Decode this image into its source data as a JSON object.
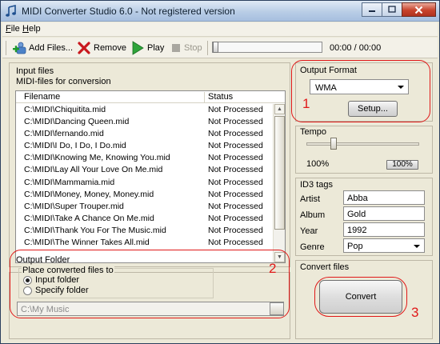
{
  "window": {
    "title": "MIDI Converter Studio 6.0 - Not registered version"
  },
  "menu": {
    "file": "File",
    "help": "Help"
  },
  "toolbar": {
    "add_files": "Add Files...",
    "remove": "Remove",
    "play": "Play",
    "stop": "Stop",
    "time": "00:00 / 00:00",
    "playback_progress": 0
  },
  "input_files": {
    "title": "Input files",
    "subtitle": "MIDI-files for conversion",
    "columns": {
      "filename": "Filename",
      "status": "Status"
    },
    "rows": [
      {
        "filename": "C:\\MIDI\\Chiquitita.mid",
        "status": "Not Processed"
      },
      {
        "filename": "C:\\MIDI\\Dancing Queen.mid",
        "status": "Not Processed"
      },
      {
        "filename": "C:\\MIDI\\fernando.mid",
        "status": "Not Processed"
      },
      {
        "filename": "C:\\MIDI\\I Do, I Do, I Do.mid",
        "status": "Not Processed"
      },
      {
        "filename": "C:\\MIDI\\Knowing Me, Knowing You.mid",
        "status": "Not Processed"
      },
      {
        "filename": "C:\\MIDI\\Lay All Your Love On Me.mid",
        "status": "Not Processed"
      },
      {
        "filename": "C:\\MIDI\\Mammamia.mid",
        "status": "Not Processed"
      },
      {
        "filename": "C:\\MIDI\\Money, Money, Money.mid",
        "status": "Not Processed"
      },
      {
        "filename": "C:\\MIDI\\Super Trouper.mid",
        "status": "Not Processed"
      },
      {
        "filename": "C:\\MIDI\\Take A Chance On Me.mid",
        "status": "Not Processed"
      },
      {
        "filename": "C:\\MIDI\\Thank You For The Music.mid",
        "status": "Not Processed"
      },
      {
        "filename": "C:\\MIDI\\The Winner Takes All.mid",
        "status": "Not Processed"
      }
    ]
  },
  "output_folder": {
    "title": "Output Folder",
    "group_label": "Place converted files to",
    "option_input": "Input folder",
    "option_specify": "Specify folder",
    "selected": "Input folder",
    "path": "C:\\My Music"
  },
  "output_format": {
    "title": "Output Format",
    "selected": "WMA",
    "setup_button": "Setup..."
  },
  "tempo": {
    "title": "Tempo",
    "value": "100%",
    "reset_button": "100%",
    "slider_level": 0.25
  },
  "id3": {
    "title": "ID3 tags",
    "artist_label": "Artist",
    "artist": "Abba",
    "album_label": "Album",
    "album": "Gold",
    "year_label": "Year",
    "year": "1992",
    "genre_label": "Genre",
    "genre": "Pop"
  },
  "convert": {
    "title": "Convert files",
    "button": "Convert"
  },
  "annotations": {
    "n1": "1",
    "n2": "2",
    "n3": "3"
  },
  "colors": {
    "highlight": "#e01818",
    "window_bg": "#ece9d8"
  }
}
